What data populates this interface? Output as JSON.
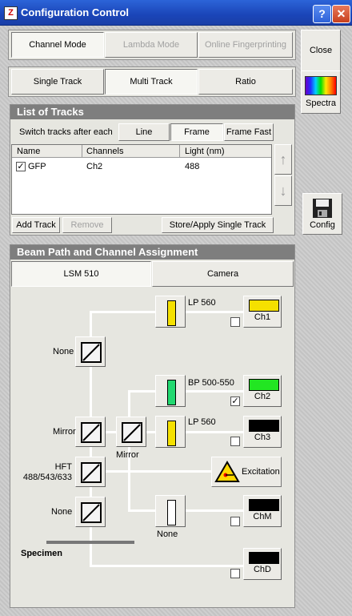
{
  "window": {
    "title": "Configuration Control",
    "help_glyph": "?",
    "close_glyph": "✕"
  },
  "modes": [
    "Channel Mode",
    "Lambda Mode",
    "Online Fingerprinting"
  ],
  "side": {
    "close": "Close",
    "spectra": "Spectra",
    "config": "Config"
  },
  "track_modes": [
    "Single Track",
    "Multi Track",
    "Ratio"
  ],
  "tracks": {
    "header": "List of Tracks",
    "switch_label": "Switch tracks after each",
    "switch_options": [
      "Line",
      "Frame",
      "Frame Fast"
    ],
    "columns": [
      "Name",
      "Channels",
      "Light (nm)"
    ],
    "rows": [
      {
        "name": "GFP",
        "channels": "Ch2",
        "light": "488",
        "checked": true
      }
    ],
    "add": "Add Track",
    "remove": "Remove",
    "store": "Store/Apply Single Track",
    "up_glyph": "↑",
    "down_glyph": "↓"
  },
  "beam": {
    "header": "Beam Path and Channel Assignment",
    "tabs": [
      "LSM 510",
      "Camera"
    ],
    "filters": {
      "lp560_top": "LP 560",
      "bp": "BP 500-550",
      "lp560_mid": "LP 560",
      "none_low": "None"
    },
    "mirrors": {
      "none_top": "None",
      "mirror_left": "Mirror",
      "mirror_mid": "Mirror",
      "hft": "HFT\n488/543/633",
      "none_bottom": "None"
    },
    "channels": [
      {
        "name": "Ch1",
        "color": "#f5e000",
        "checked": false
      },
      {
        "name": "Ch2",
        "color": "#22e622",
        "checked": true
      },
      {
        "name": "Ch3",
        "color": "#000000",
        "checked": false
      },
      {
        "name": "ChM",
        "color": "#000000",
        "checked": false
      },
      {
        "name": "ChD",
        "color": "#000000",
        "checked": false
      }
    ],
    "excitation": "Excitation",
    "specimen": "Specimen",
    "check_glyph": "✓"
  },
  "colors": {
    "yellow": "#f5e000",
    "green": "#22d870"
  }
}
